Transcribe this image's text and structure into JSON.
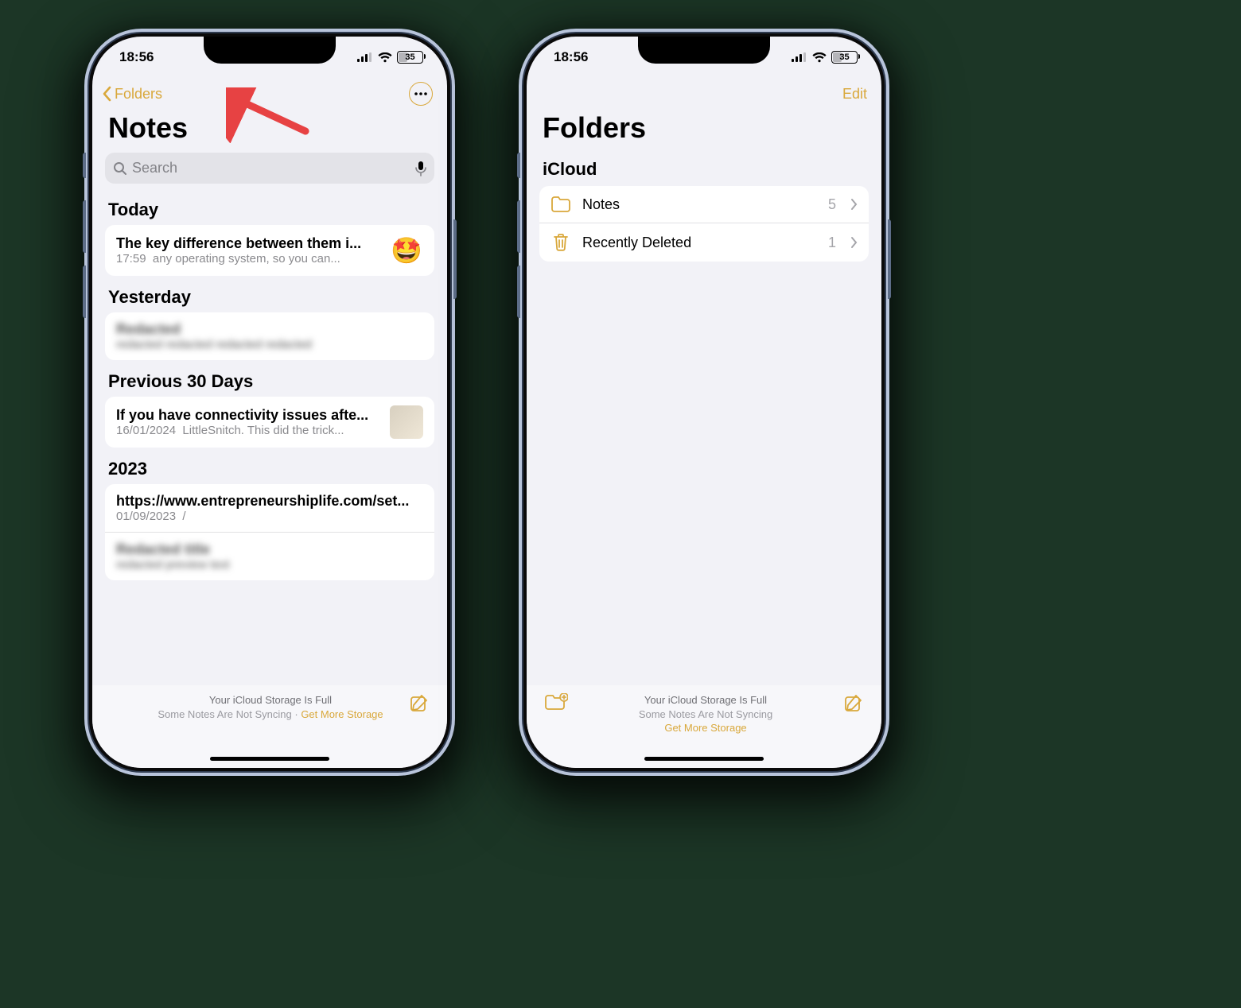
{
  "status": {
    "time": "18:56",
    "battery_pct": "35"
  },
  "notes_screen": {
    "back_label": "Folders",
    "title": "Notes",
    "search_placeholder": "Search",
    "sections": [
      {
        "header": "Today",
        "notes": [
          {
            "title": "The key difference between them i...",
            "time": "17:59",
            "preview": "any operating system, so you can...",
            "thumb": "emoji-star"
          }
        ]
      },
      {
        "header": "Yesterday",
        "notes": [
          {
            "title": "Redacted",
            "time": "",
            "preview": "redacted redacted redacted redacted",
            "redacted": true
          }
        ]
      },
      {
        "header": "Previous 30 Days",
        "notes": [
          {
            "title": "If you have connectivity issues afte...",
            "time": "16/01/2024",
            "preview": "LittleSnitch. This did the trick...",
            "thumb": "image"
          }
        ]
      },
      {
        "header": "2023",
        "notes": [
          {
            "title": "https://www.entrepreneurshiplife.com/set...",
            "time": "01/09/2023",
            "preview": "/"
          },
          {
            "title": "Redacted title",
            "time": "",
            "preview": "redacted preview text",
            "redacted": true
          }
        ]
      }
    ],
    "footer": {
      "line1": "Your iCloud Storage Is Full",
      "line2_a": "Some Notes Are Not Syncing ",
      "dot": "·",
      "link": "Get More Storage"
    }
  },
  "folders_screen": {
    "edit_label": "Edit",
    "title": "Folders",
    "group": "iCloud",
    "rows": [
      {
        "icon": "folder",
        "label": "Notes",
        "count": "5"
      },
      {
        "icon": "trash",
        "label": "Recently Deleted",
        "count": "1"
      }
    ],
    "footer": {
      "line1": "Your iCloud Storage Is Full",
      "line2": "Some Notes Are Not Syncing",
      "link": "Get More Storage"
    }
  }
}
